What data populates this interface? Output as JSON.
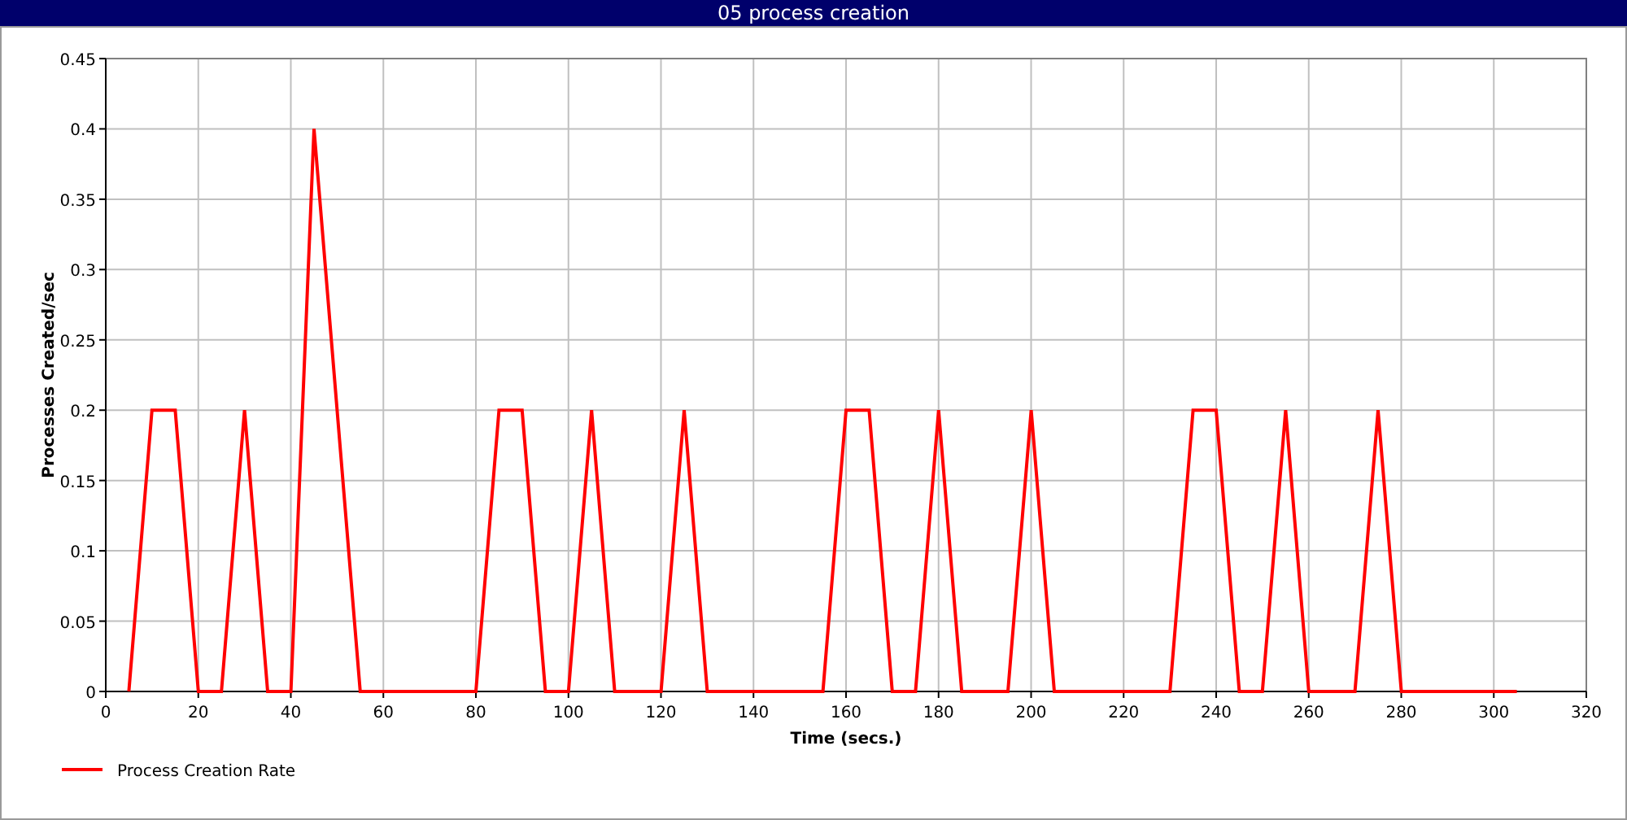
{
  "window": {
    "title": "05 process creation"
  },
  "chart": {
    "chart_data": {
      "type": "line",
      "grid": true,
      "xlabel": "Time (secs.)",
      "ylabel": "Processes Created/sec",
      "xlim": [
        0,
        320
      ],
      "ylim": [
        0,
        0.45
      ],
      "xticks": [
        0,
        20,
        40,
        60,
        80,
        100,
        120,
        140,
        160,
        180,
        200,
        220,
        240,
        260,
        280,
        300,
        320
      ],
      "yticks": [
        0,
        0.05,
        0.1,
        0.15,
        0.2,
        0.25,
        0.3,
        0.35,
        0.4,
        0.45
      ],
      "x": [
        5,
        10,
        15,
        20,
        25,
        30,
        35,
        40,
        45,
        50,
        55,
        60,
        65,
        70,
        75,
        80,
        85,
        90,
        95,
        100,
        105,
        110,
        115,
        120,
        125,
        130,
        135,
        140,
        145,
        150,
        155,
        160,
        165,
        170,
        175,
        180,
        185,
        190,
        195,
        200,
        205,
        210,
        215,
        220,
        225,
        230,
        235,
        240,
        245,
        250,
        255,
        260,
        265,
        270,
        275,
        280,
        285,
        290,
        295,
        300,
        305
      ],
      "series": [
        {
          "name": "Process Creation Rate",
          "color": "#ff0000",
          "values": [
            0,
            0.2,
            0.2,
            0,
            0,
            0.2,
            0,
            0,
            0.4,
            0.2,
            0,
            0,
            0,
            0,
            0,
            0,
            0.2,
            0.2,
            0,
            0,
            0.2,
            0,
            0,
            0,
            0.2,
            0,
            0,
            0,
            0,
            0,
            0,
            0.2,
            0.2,
            0,
            0,
            0.2,
            0,
            0,
            0,
            0.2,
            0,
            0,
            0,
            0,
            0,
            0,
            0.2,
            0.2,
            0,
            0,
            0.2,
            0,
            0,
            0,
            0.2,
            0,
            0,
            0,
            0,
            0,
            0
          ]
        }
      ]
    }
  }
}
